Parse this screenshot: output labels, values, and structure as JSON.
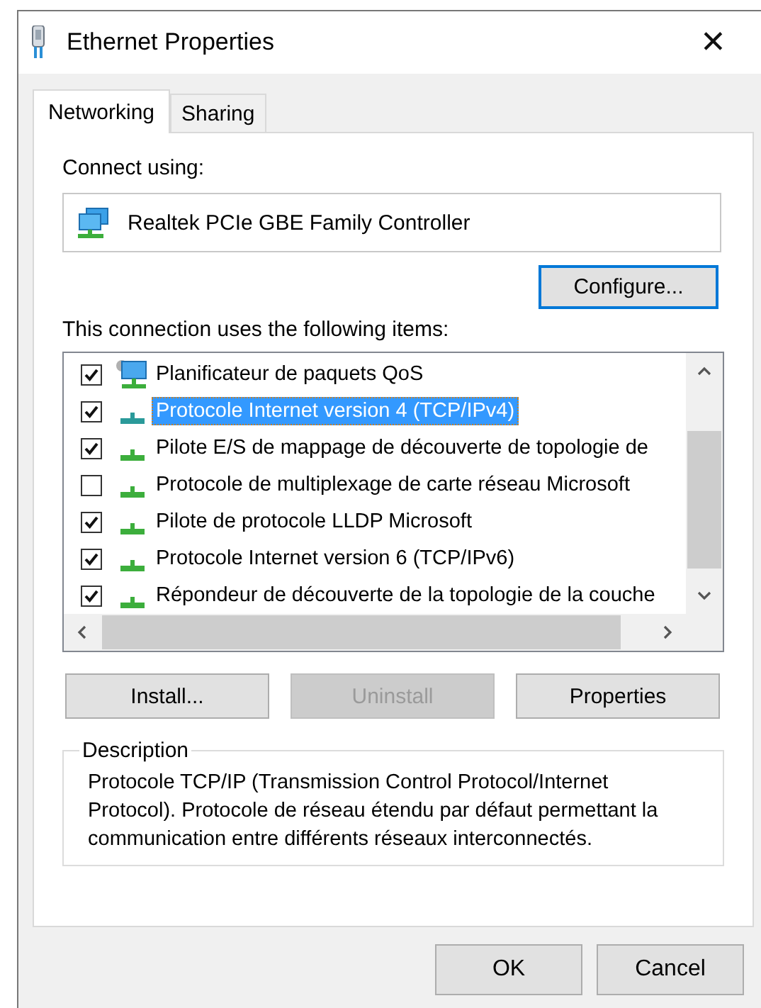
{
  "window": {
    "title": "Ethernet Properties",
    "close": "✕"
  },
  "tabs": [
    {
      "label": "Networking",
      "selected": true
    },
    {
      "label": "Sharing",
      "selected": false
    }
  ],
  "connect_using": {
    "label": "Connect using:",
    "adapter": "Realtek PCIe GBE Family Controller"
  },
  "configure_button": {
    "label": "Configure...",
    "focused": true
  },
  "items_label": "This connection uses the following items:",
  "items": [
    {
      "label": "Planificateur de paquets QoS",
      "checked": true,
      "selected": false,
      "kind": "service"
    },
    {
      "label": "Protocole Internet version 4 (TCP/IPv4)",
      "checked": true,
      "selected": true,
      "kind": "protocol"
    },
    {
      "label": "Pilote E/S de mappage de découverte de topologie de",
      "checked": true,
      "selected": false,
      "kind": "protocol"
    },
    {
      "label": "Protocole de multiplexage de carte réseau Microsoft",
      "checked": false,
      "selected": false,
      "kind": "protocol"
    },
    {
      "label": "Pilote de protocole LLDP Microsoft",
      "checked": true,
      "selected": false,
      "kind": "protocol"
    },
    {
      "label": "Protocole Internet version 6 (TCP/IPv6)",
      "checked": true,
      "selected": false,
      "kind": "protocol"
    },
    {
      "label": "Répondeur de découverte de la topologie de la couche",
      "checked": true,
      "selected": false,
      "kind": "protocol"
    }
  ],
  "item_buttons": [
    {
      "label": "Install...",
      "disabled": false
    },
    {
      "label": "Uninstall",
      "disabled": true
    },
    {
      "label": "Properties",
      "disabled": false
    }
  ],
  "description": {
    "legend": "Description",
    "text": "Protocole TCP/IP (Transmission Control Protocol/Internet Protocol). Protocole de réseau étendu par défaut permettant la communication entre différents réseaux interconnectés."
  },
  "dialog_buttons": [
    {
      "label": "OK"
    },
    {
      "label": "Cancel"
    }
  ]
}
